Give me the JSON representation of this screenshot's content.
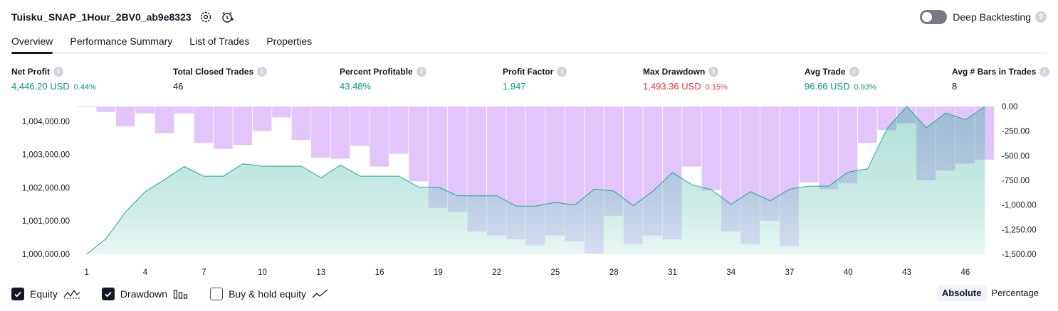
{
  "header": {
    "title": "Tuisku_SNAP_1Hour_2BV0_ab9e8323",
    "deep_backtesting_label": "Deep Backtesting",
    "help_glyph": "?"
  },
  "tabs": [
    {
      "label": "Overview",
      "active": true
    },
    {
      "label": "Performance Summary",
      "active": false
    },
    {
      "label": "List of Trades",
      "active": false
    },
    {
      "label": "Properties",
      "active": false
    }
  ],
  "metrics": {
    "net_profit": {
      "label": "Net Profit",
      "value": "4,446.20 USD",
      "pct": "0.44%"
    },
    "total_closed_trades": {
      "label": "Total Closed Trades",
      "value": "46"
    },
    "percent_profitable": {
      "label": "Percent Profitable",
      "value": "43.48%"
    },
    "profit_factor": {
      "label": "Profit Factor",
      "value": "1.947"
    },
    "max_drawdown": {
      "label": "Max Drawdown",
      "value": "1,493.36 USD",
      "pct": "0.15%"
    },
    "avg_trade": {
      "label": "Avg Trade",
      "value": "96.66 USD",
      "pct": "0.93%"
    },
    "avg_bars": {
      "label": "Avg # Bars in Trades",
      "value": "8"
    },
    "info_glyph": "i"
  },
  "legend": {
    "equity": {
      "label": "Equity",
      "checked": true
    },
    "drawdown": {
      "label": "Drawdown",
      "checked": true
    },
    "buy_hold": {
      "label": "Buy & hold equity",
      "checked": false
    }
  },
  "mode": {
    "absolute": "Absolute",
    "percentage": "Percentage",
    "selected": "Absolute"
  },
  "colors": {
    "equity_line": "#22ab94",
    "equity_fill": "#d5f0ea",
    "drawdown_bar": "#e1c5fb",
    "profit_text": "#089981",
    "loss_text": "#f23645"
  },
  "chart_data": {
    "type": "area",
    "x_ticks": [
      1,
      4,
      7,
      10,
      13,
      16,
      19,
      22,
      25,
      28,
      31,
      34,
      37,
      40,
      43,
      46
    ],
    "left_axis": {
      "ticks": [
        "1,000,000.00",
        "1,001,000.00",
        "1,002,000.00",
        "1,003,000.00",
        "1,004,000.00"
      ],
      "range": [
        1000000,
        1004446
      ]
    },
    "right_axis": {
      "ticks": [
        "0.00",
        "-250.00",
        "-500.00",
        "-750.00",
        "-1,000.00",
        "-1,250.00",
        "-1,500.00"
      ],
      "range": [
        -1500,
        0
      ]
    },
    "series": [
      {
        "name": "Equity",
        "axis": "left",
        "x": [
          1,
          2,
          3,
          4,
          5,
          6,
          7,
          8,
          9,
          10,
          11,
          12,
          13,
          14,
          15,
          16,
          17,
          18,
          19,
          20,
          21,
          22,
          23,
          24,
          25,
          26,
          27,
          28,
          29,
          30,
          31,
          32,
          33,
          34,
          35,
          36,
          37,
          38,
          39,
          40,
          41,
          42,
          43,
          44,
          45,
          46,
          47
        ],
        "values": [
          1000000,
          1000470,
          1001280,
          1001880,
          1002250,
          1002640,
          1002350,
          1002350,
          1002720,
          1002650,
          1002650,
          1002650,
          1002300,
          1002680,
          1002350,
          1002350,
          1002350,
          1002020,
          1002020,
          1001760,
          1001760,
          1001760,
          1001450,
          1001450,
          1001560,
          1001480,
          1001960,
          1001900,
          1001460,
          1001900,
          1002460,
          1002090,
          1001940,
          1001500,
          1001880,
          1001610,
          1001960,
          1002050,
          1002050,
          1002470,
          1002570,
          1003790,
          1004446,
          1003810,
          1004250,
          1004050,
          1004446
        ]
      },
      {
        "name": "Drawdown",
        "axis": "right",
        "x": [
          1,
          2,
          3,
          4,
          5,
          6,
          7,
          8,
          9,
          10,
          11,
          12,
          13,
          14,
          15,
          16,
          17,
          18,
          19,
          20,
          21,
          22,
          23,
          24,
          25,
          26,
          27,
          28,
          29,
          30,
          31,
          32,
          33,
          34,
          35,
          36,
          37,
          38,
          39,
          40,
          41,
          42,
          43,
          44,
          45,
          46,
          47
        ],
        "values": [
          -5,
          -55,
          -200,
          -70,
          -270,
          -70,
          -370,
          -430,
          -390,
          -250,
          -110,
          -340,
          -520,
          -530,
          -400,
          -610,
          -480,
          -760,
          -1030,
          -1070,
          -1270,
          -1310,
          -1350,
          -1410,
          -1310,
          -1370,
          -1493,
          -1110,
          -1400,
          -1310,
          -1350,
          -610,
          -850,
          -1270,
          -1400,
          -1160,
          -1420,
          -770,
          -840,
          -780,
          -370,
          -240,
          -170,
          -750,
          -650,
          -580,
          -540
        ]
      }
    ]
  }
}
